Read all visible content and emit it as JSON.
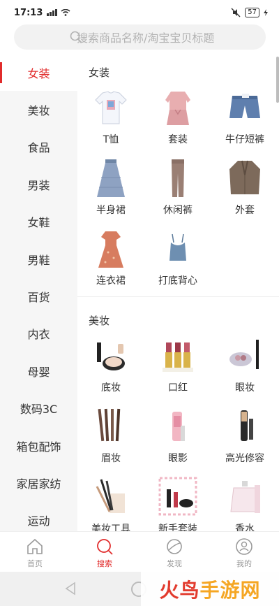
{
  "status": {
    "time": "17:13",
    "battery": "57"
  },
  "search": {
    "placeholder": "搜索商品名称/淘宝宝贝标题"
  },
  "sidebar": {
    "items": [
      {
        "label": "女装"
      },
      {
        "label": "美妆"
      },
      {
        "label": "食品"
      },
      {
        "label": "男装"
      },
      {
        "label": "女鞋"
      },
      {
        "label": "男鞋"
      },
      {
        "label": "百货"
      },
      {
        "label": "内衣"
      },
      {
        "label": "母婴"
      },
      {
        "label": "数码3C"
      },
      {
        "label": "箱包配饰"
      },
      {
        "label": "家居家纺"
      },
      {
        "label": "运动"
      }
    ]
  },
  "sections": [
    {
      "title": "女装",
      "items": [
        {
          "label": "T恤",
          "icon": "tshirt-icon"
        },
        {
          "label": "套装",
          "icon": "suit-icon"
        },
        {
          "label": "牛仔短裤",
          "icon": "denim-shorts-icon"
        },
        {
          "label": "半身裙",
          "icon": "skirt-icon"
        },
        {
          "label": "休闲裤",
          "icon": "pants-icon"
        },
        {
          "label": "外套",
          "icon": "coat-icon"
        },
        {
          "label": "连衣裙",
          "icon": "dress-icon"
        },
        {
          "label": "打底背心",
          "icon": "vest-icon"
        }
      ]
    },
    {
      "title": "美妆",
      "items": [
        {
          "label": "底妆",
          "icon": "foundation-icon"
        },
        {
          "label": "口红",
          "icon": "lipstick-icon"
        },
        {
          "label": "眼妆",
          "icon": "eye-makeup-icon"
        },
        {
          "label": "眉妆",
          "icon": "brow-pencil-icon"
        },
        {
          "label": "眼影",
          "icon": "eyeshadow-icon"
        },
        {
          "label": "高光修容",
          "icon": "highlighter-icon"
        },
        {
          "label": "美妆工具",
          "icon": "brush-tools-icon"
        },
        {
          "label": "新手套装",
          "icon": "starter-kit-icon"
        },
        {
          "label": "香水",
          "icon": "perfume-icon"
        }
      ]
    }
  ],
  "tabbar": {
    "items": [
      {
        "label": "首页"
      },
      {
        "label": "搜索"
      },
      {
        "label": "发现"
      },
      {
        "label": "我的"
      }
    ]
  },
  "watermark": {
    "part1": "火鸟",
    "part2": "手游网"
  },
  "colors": {
    "accent": "#e12b2b",
    "sidebar_bg": "#f6f6f6",
    "muted": "#9a9a9a"
  }
}
